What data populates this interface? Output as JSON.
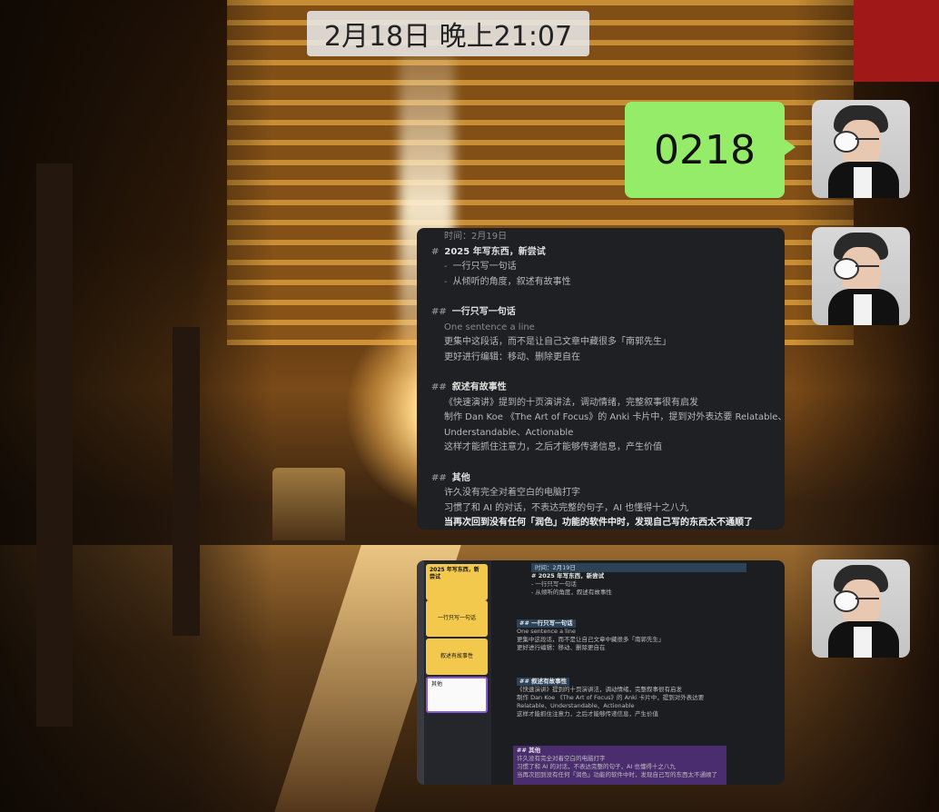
{
  "timestamp": "2月18日 晚上21:07",
  "message_text": "0218",
  "note_editor": {
    "lines": [
      {
        "kind": "meta",
        "text": "时间：2月19日"
      },
      {
        "kind": "h",
        "hash": "#",
        "text": "2025 年写东西，新尝试"
      },
      {
        "kind": "b",
        "text": "一行只写一句话"
      },
      {
        "kind": "b",
        "text": "从倾听的角度，叙述有故事性"
      },
      {
        "kind": "gap",
        "text": ""
      },
      {
        "kind": "h",
        "hash": "##",
        "text": "一行只写一句话"
      },
      {
        "kind": "p",
        "dim": true,
        "text": "One sentence a line"
      },
      {
        "kind": "p",
        "text": "更集中这段话，而不是让自己文章中藏很多「南郭先生」"
      },
      {
        "kind": "p",
        "text": "更好进行编辑：移动、删除更自在"
      },
      {
        "kind": "gap",
        "text": ""
      },
      {
        "kind": "h",
        "hash": "##",
        "text": "叙述有故事性"
      },
      {
        "kind": "p",
        "text": "《快速演讲》提到的十页演讲法，调动情绪，完整叙事很有启发"
      },
      {
        "kind": "p",
        "text": "制作 Dan Koe 《The Art of Focus》的 Anki 卡片中，提到对外表达要 Relatable、"
      },
      {
        "kind": "p",
        "text": "Understandable、Actionable"
      },
      {
        "kind": "p",
        "text": "这样才能抓住注意力，之后才能够传递信息，产生价值"
      },
      {
        "kind": "gap",
        "text": ""
      },
      {
        "kind": "h",
        "hash": "##",
        "text": "其他"
      },
      {
        "kind": "p",
        "text": "许久没有完全对着空白的电脑打字"
      },
      {
        "kind": "p",
        "text": "习惯了和 AI 的对话，不表达完整的句子，AI 也懂得十之八九"
      },
      {
        "kind": "sel",
        "text": "当再次回到没有任何「润色」功能的软件中时，发现自己写的东西太不通顺了"
      }
    ]
  },
  "canvas_view": {
    "cards": [
      {
        "style": "y",
        "text": "2025 年写东西，新尝试"
      },
      {
        "style": "y",
        "text": "一行只写一句话"
      },
      {
        "style": "y",
        "text": "叙述有故事性"
      },
      {
        "style": "w",
        "text": "其他"
      }
    ],
    "head_ribbon": "时间：2月19日",
    "head_block": [
      "# 2025 年写东西，新尝试",
      "- 一行只写一句话",
      "- 从倾听的角度，叙述有故事性"
    ],
    "block2_title": "## 一行只写一句话",
    "block2": [
      "One sentence a line",
      "更集中这段话，而不是让自己文章中藏很多「南郭先生」",
      "更好进行编辑：移动、删除更自在"
    ],
    "block3_title": "## 叙述有故事性",
    "block3": [
      "《快速演讲》提到的十页演讲法，调动情绪，完整叙事很有启发",
      "制作 Dan Koe 《The Art of Focus》的 Anki 卡片中，提到对外表达要",
      "Relatable、Understandable、Actionable",
      "这样才能抓住注意力，之后才能够传递信息，产生价值"
    ],
    "block4_title": "## 其他",
    "block4": [
      "许久没有完全对着空白的电脑打字",
      "习惯了和 AI 的对话，不表达完整的句子，AI 也懂得十之八九",
      "当再次回到没有任何「润色」功能的软件中时，发现自己写的东西太不通顺了"
    ]
  },
  "colors": {
    "bubble": "#95ec69",
    "editor_bg": "#1f2024",
    "card_yellow": "#f2c94c",
    "card_purple_border": "#8a5bd6"
  }
}
